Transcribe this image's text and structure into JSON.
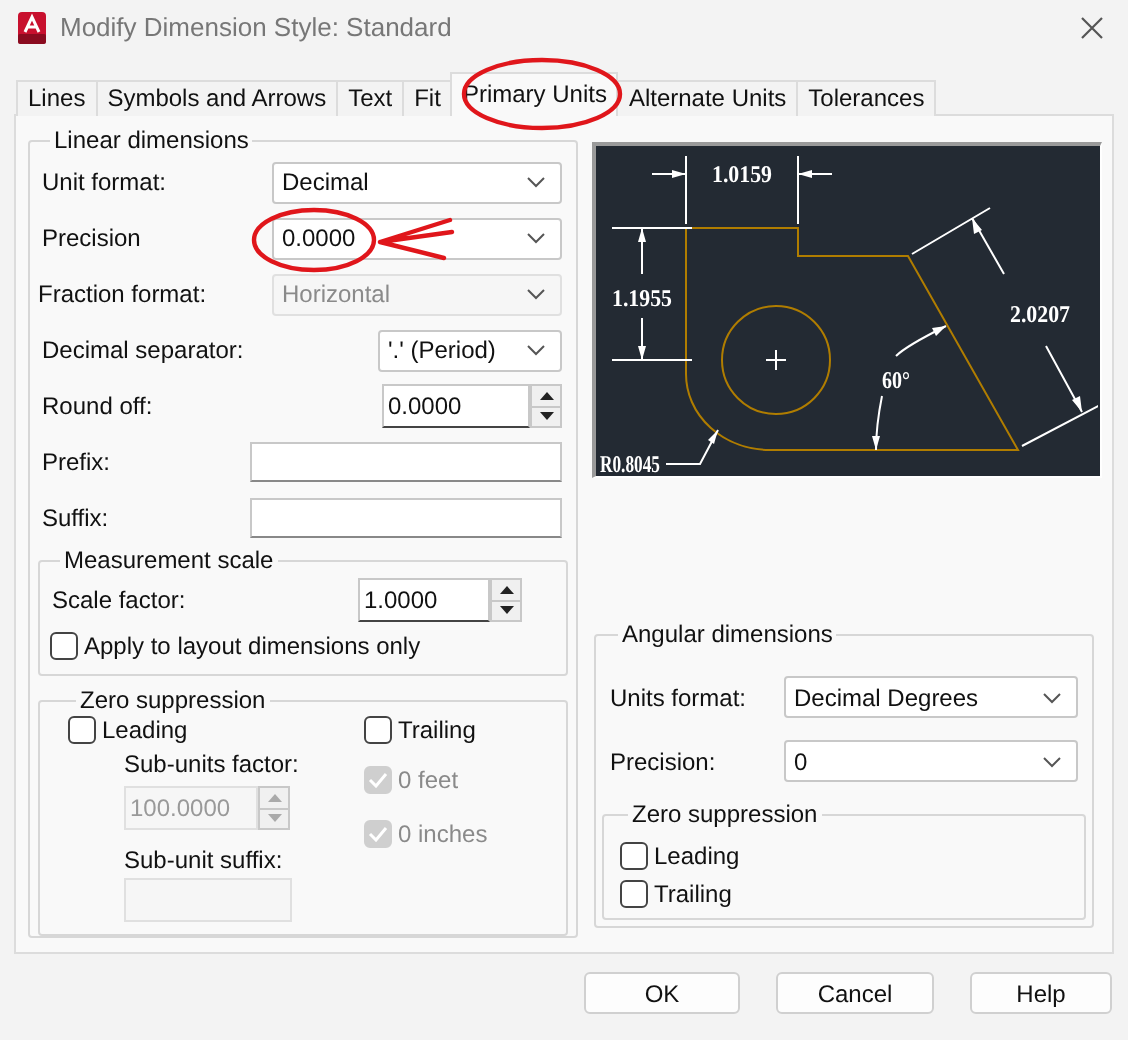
{
  "window": {
    "title": "Modify Dimension Style: Standard"
  },
  "tabs": [
    {
      "label": "Lines",
      "selected": false
    },
    {
      "label": "Symbols and Arrows",
      "selected": false
    },
    {
      "label": "Text",
      "selected": false
    },
    {
      "label": "Fit",
      "selected": false
    },
    {
      "label": "Primary Units",
      "selected": true
    },
    {
      "label": "Alternate Units",
      "selected": false
    },
    {
      "label": "Tolerances",
      "selected": false
    }
  ],
  "linear_dimensions": {
    "title": "Linear dimensions",
    "fields": [
      {
        "kind": "dropdown",
        "label": "Unit format:",
        "value": "Decimal",
        "disabled": false
      },
      {
        "kind": "dropdown",
        "label": "Precision",
        "value": "0.0000",
        "disabled": false
      },
      {
        "kind": "dropdown",
        "label": "Fraction format:",
        "value": "Horizontal",
        "disabled": true
      },
      {
        "kind": "dropdown",
        "label": "Decimal separator:",
        "value": "'.' (Period)",
        "disabled": false
      },
      {
        "kind": "spinner",
        "label": "Round off:",
        "value": "0.0000",
        "disabled": false
      },
      {
        "kind": "text",
        "label": "Prefix:",
        "disabled": false
      },
      {
        "kind": "text",
        "label": "Suffix:",
        "disabled": false
      }
    ]
  },
  "measurement_scale": {
    "title": "Measurement scale",
    "scale_factor": {
      "label": "Scale factor:",
      "value": "1.0000"
    },
    "apply_to_layout": {
      "label": "Apply to layout dimensions only",
      "checked": false
    }
  },
  "zero_suppression": {
    "title": "Zero suppression",
    "options": [
      {
        "label": "Leading",
        "checked": false,
        "disabled": false
      },
      {
        "label": "Trailing",
        "checked": false,
        "disabled": false
      },
      {
        "label": "0 feet",
        "checked": true,
        "disabled": true
      },
      {
        "label": "0 inches",
        "checked": true,
        "disabled": true
      }
    ],
    "sub_units_factor": {
      "label": "Sub-units factor:",
      "value": "100.0000",
      "disabled": true
    },
    "sub_unit_suffix": {
      "label": "Sub-unit suffix:",
      "disabled": true
    }
  },
  "preview": {
    "dimension_labels": [
      "1.0159",
      "1.1955",
      "2.0207",
      "60°",
      "R0.8045"
    ]
  },
  "angular_dimensions": {
    "title": "Angular dimensions",
    "units_format": {
      "label": "Units format:",
      "value": "Decimal Degrees"
    },
    "precision": {
      "label": "Precision:",
      "value": "0"
    },
    "zero_suppression": {
      "title": "Zero suppression",
      "options": [
        {
          "label": "Leading",
          "checked": false
        },
        {
          "label": "Trailing",
          "checked": false
        }
      ]
    }
  },
  "buttons": [
    "OK",
    "Cancel",
    "Help"
  ]
}
